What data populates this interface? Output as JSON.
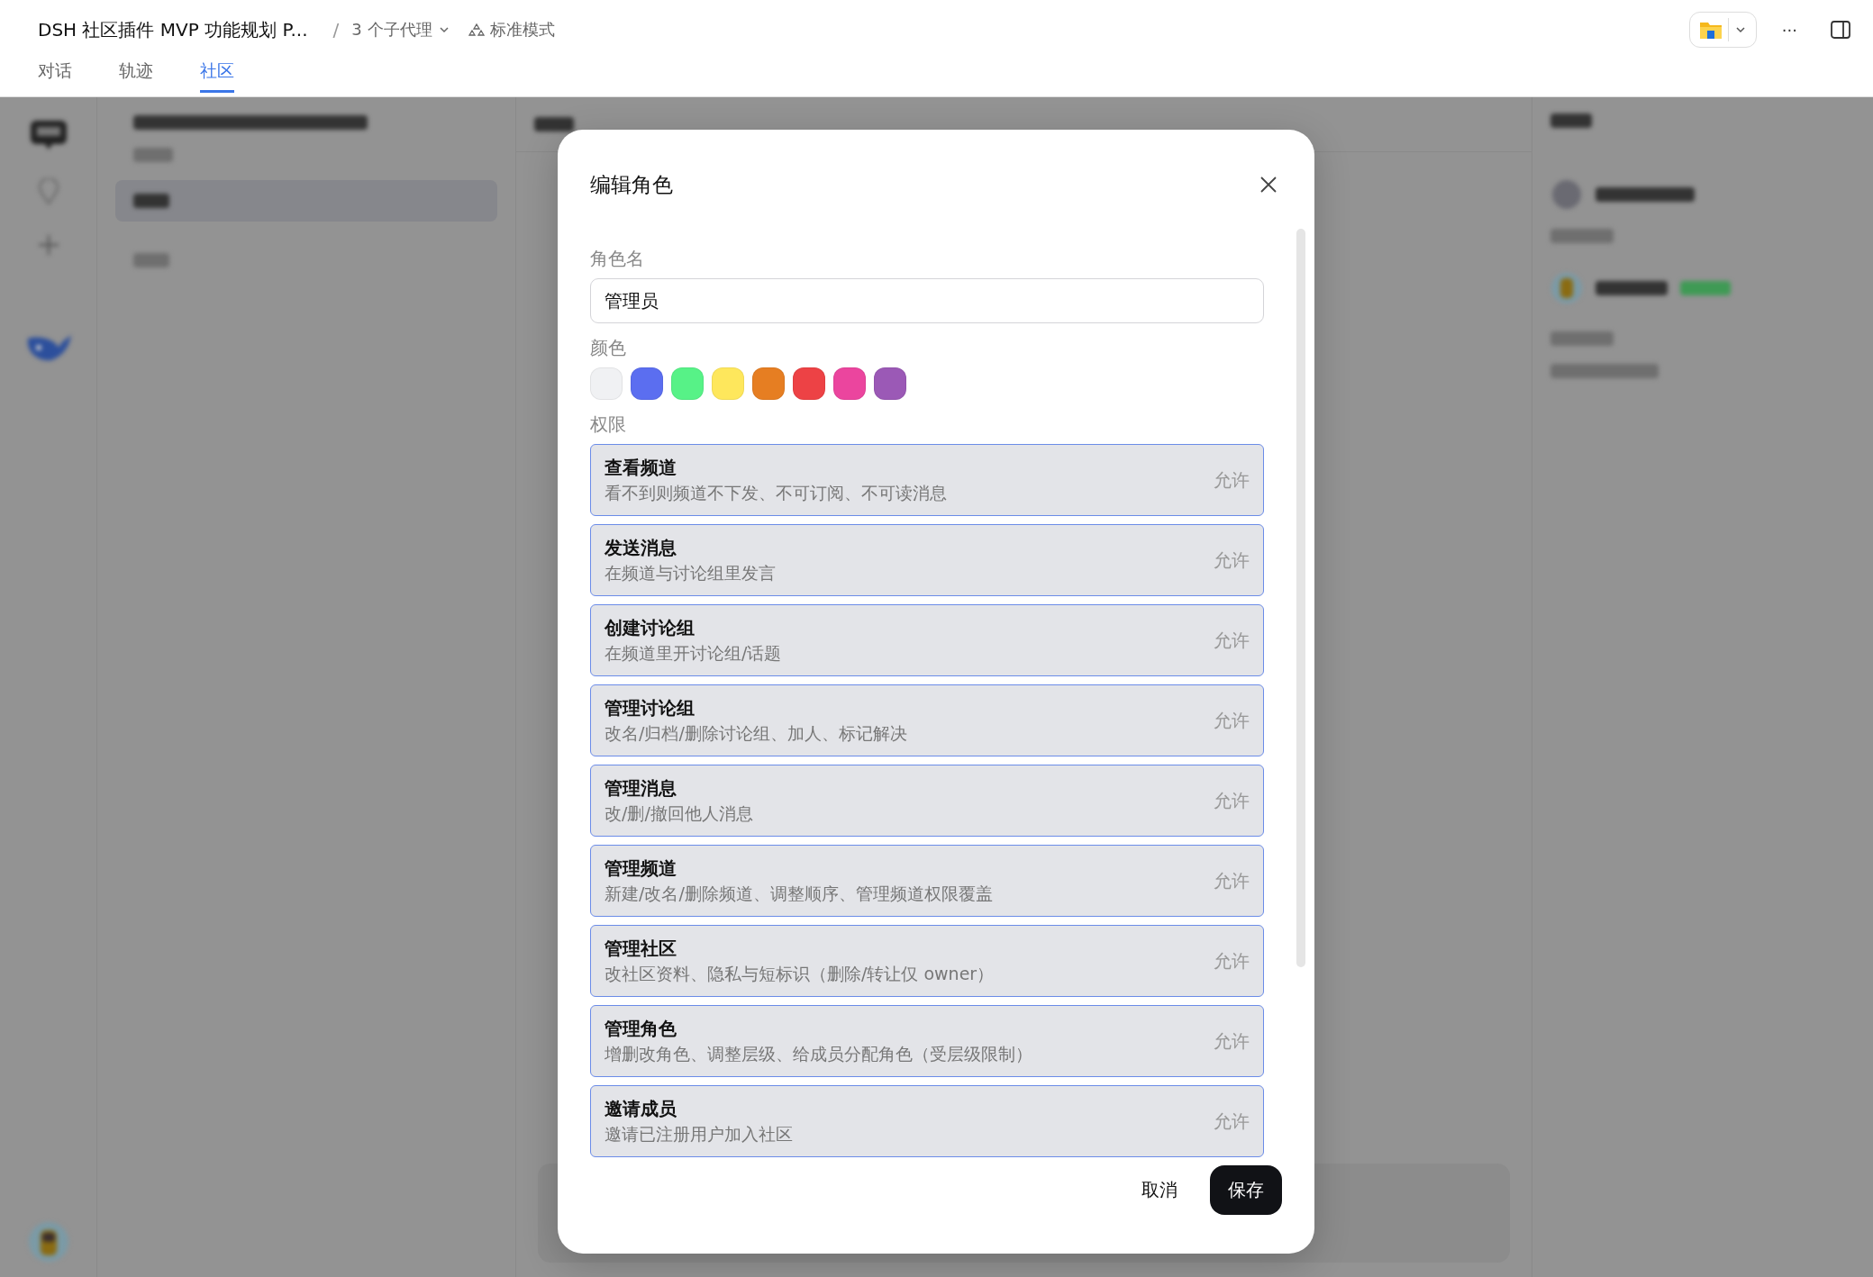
{
  "header": {
    "title": "DSH 社区插件 MVP 功能规划 P...",
    "separator": "/",
    "agents": "3 个子代理",
    "mode": "标准模式",
    "more": "···"
  },
  "tabs": [
    {
      "label": "对话",
      "selected": false
    },
    {
      "label": "轨迹",
      "selected": false
    },
    {
      "label": "社区",
      "selected": true
    }
  ],
  "dialog": {
    "title": "编辑角色",
    "name_label": "角色名",
    "name_value": "管理员",
    "color_label": "颜色",
    "colors": [
      {
        "color": "#f0f1f3"
      },
      {
        "color": "#5b6ef0"
      },
      {
        "color": "#57f287"
      },
      {
        "color": "#fee75c"
      },
      {
        "color": "#e67e22"
      },
      {
        "color": "#ed4245"
      },
      {
        "color": "#eb459e"
      },
      {
        "color": "#9b59b6"
      }
    ],
    "permissions_label": "权限",
    "permissions": [
      {
        "title": "查看频道",
        "description": "看不到则频道不下发、不可订阅、不可读消息",
        "value": "允许"
      },
      {
        "title": "发送消息",
        "description": "在频道与讨论组里发言",
        "value": "允许"
      },
      {
        "title": "创建讨论组",
        "description": "在频道里开讨论组/话题",
        "value": "允许"
      },
      {
        "title": "管理讨论组",
        "description": "改名/归档/删除讨论组、加人、标记解决",
        "value": "允许"
      },
      {
        "title": "管理消息",
        "description": "改/删/撤回他人消息",
        "value": "允许"
      },
      {
        "title": "管理频道",
        "description": "新建/改名/删除频道、调整顺序、管理频道权限覆盖",
        "value": "允许"
      },
      {
        "title": "管理社区",
        "description": "改社区资料、隐私与短标识（删除/转让仅 owner）",
        "value": "允许"
      },
      {
        "title": "管理角色",
        "description": "增删改角色、调整层级、给成员分配角色（受层级限制）",
        "value": "允许"
      },
      {
        "title": "邀请成员",
        "description": "邀请已注册用户加入社区",
        "value": "允许"
      }
    ],
    "buttons": {
      "cancel": "取消",
      "save": "保存"
    }
  }
}
